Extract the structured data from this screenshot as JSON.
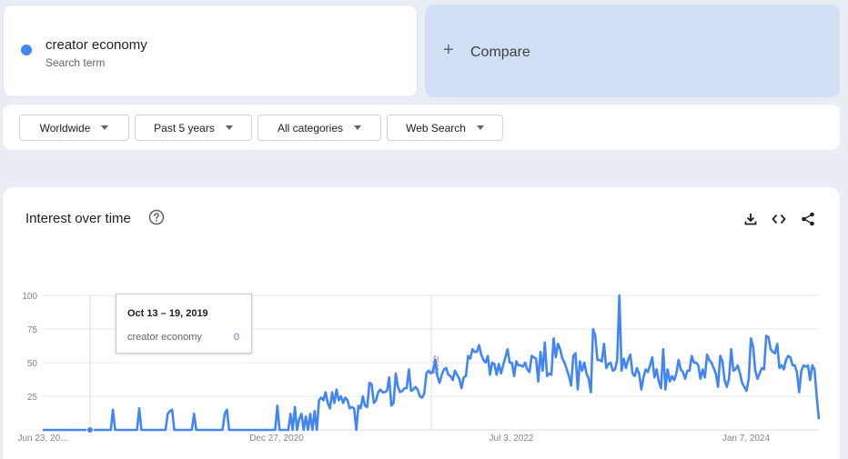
{
  "search_term": {
    "name": "creator economy",
    "sublabel": "Search term",
    "color": "#4285f4"
  },
  "compare": {
    "icon": "plus-icon",
    "label": "Compare"
  },
  "filters": [
    {
      "label": "Worldwide",
      "icon": "caret-down-icon"
    },
    {
      "label": "Past 5 years",
      "icon": "caret-down-icon"
    },
    {
      "label": "All categories",
      "icon": "caret-down-icon"
    },
    {
      "label": "Web Search",
      "icon": "caret-down-icon"
    }
  ],
  "interest_card": {
    "title": "Interest over time",
    "icons": [
      "help-icon",
      "download-icon",
      "embed-code-icon",
      "share-icon"
    ],
    "note_label": "Note"
  },
  "tooltip": {
    "date": "Oct 13 – 19, 2019",
    "term": "creator economy",
    "value": "0"
  },
  "chart_data": {
    "type": "line",
    "title": "Interest over time",
    "x_tick_labels": [
      "Jun 23, 20...",
      "Dec 27, 2020",
      "Jul 3, 2022",
      "Jan 7, 2024"
    ],
    "y_ticks": [
      25,
      50,
      75,
      100
    ],
    "ylim": [
      0,
      100
    ],
    "grid": true,
    "series": [
      {
        "name": "creator economy",
        "color": "#4285f4",
        "values": [
          0,
          0,
          0,
          0,
          0,
          0,
          0,
          0,
          0,
          0,
          0,
          0,
          0,
          0,
          0,
          0,
          0,
          0,
          0,
          0,
          0,
          0,
          0,
          0,
          0,
          0,
          0,
          0,
          0,
          0,
          0,
          0,
          15,
          0,
          0,
          0,
          0,
          0,
          0,
          0,
          0,
          0,
          0,
          0,
          16,
          0,
          0,
          0,
          0,
          0,
          0,
          0,
          0,
          0,
          0,
          0,
          0,
          12,
          14,
          15,
          0,
          0,
          0,
          0,
          0,
          0,
          0,
          0,
          0,
          12,
          0,
          0,
          0,
          0,
          0,
          0,
          0,
          0,
          0,
          0,
          0,
          0,
          0,
          12,
          15,
          0,
          0,
          0,
          0,
          0,
          0,
          0,
          0,
          0,
          0,
          0,
          0,
          0,
          0,
          0,
          0,
          0,
          0,
          0,
          0,
          0,
          0,
          18,
          0,
          0,
          0,
          0,
          0,
          12,
          0,
          17,
          0,
          8,
          12,
          0,
          10,
          0,
          12,
          0,
          14,
          0,
          22,
          24,
          22,
          28,
          20,
          16,
          28,
          20,
          30,
          22,
          25,
          20,
          24,
          22,
          16,
          17,
          16,
          0,
          18,
          16,
          25,
          18,
          17,
          35,
          34,
          20,
          22,
          28,
          30,
          28,
          28,
          29,
          39,
          18,
          20,
          42,
          32,
          28,
          29,
          31,
          31,
          45,
          29,
          30,
          32,
          30,
          25,
          24,
          27,
          42,
          44,
          42,
          44,
          52,
          40,
          35,
          41,
          45,
          46,
          41,
          40,
          37,
          44,
          41,
          38,
          31,
          39,
          40,
          55,
          53,
          60,
          58,
          58,
          63,
          56,
          52,
          50,
          55,
          41,
          50,
          49,
          41,
          49,
          42,
          48,
          54,
          60,
          50,
          50,
          40,
          51,
          48,
          48,
          47,
          50,
          45,
          43,
          55,
          54,
          53,
          36,
          58,
          44,
          65,
          40,
          42,
          41,
          68,
          54,
          64,
          60,
          53,
          50,
          45,
          40,
          33,
          55,
          57,
          30,
          51,
          44,
          50,
          42,
          38,
          28,
          75,
          70,
          52,
          52,
          51,
          64,
          46,
          49,
          50,
          44,
          45,
          52,
          100,
          44,
          53,
          46,
          52,
          56,
          42,
          40,
          46,
          42,
          30,
          39,
          45,
          43,
          48,
          54,
          39,
          45,
          36,
          31,
          60,
          30,
          45,
          36,
          40,
          37,
          42,
          52,
          45,
          43,
          38,
          44,
          44,
          55,
          50,
          50,
          48,
          38,
          45,
          39,
          56,
          52,
          50,
          46,
          42,
          32,
          55,
          51,
          37,
          32,
          38,
          60,
          44,
          45,
          48,
          42,
          35,
          32,
          29,
          38,
          68,
          62,
          44,
          38,
          42,
          46,
          45,
          70,
          69,
          60,
          58,
          57,
          64,
          46,
          48,
          45,
          52,
          55,
          54,
          48,
          48,
          43,
          28,
          44,
          48,
          47,
          48,
          37,
          48,
          45,
          25,
          8
        ]
      }
    ]
  }
}
